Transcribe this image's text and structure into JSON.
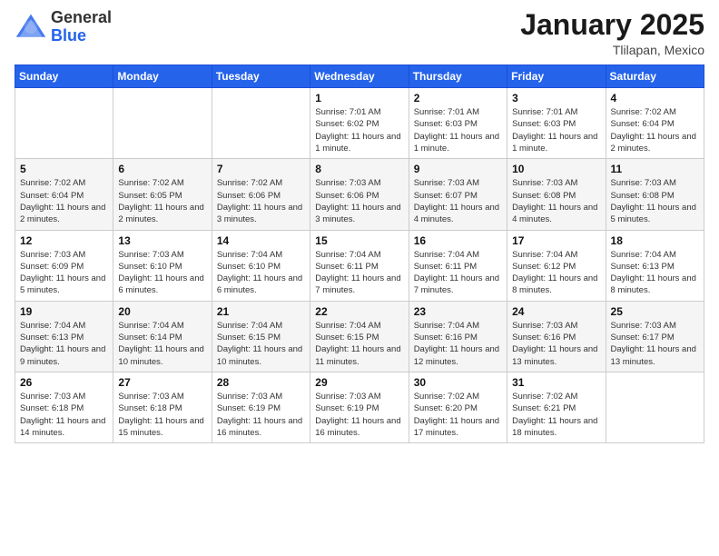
{
  "header": {
    "logo_general": "General",
    "logo_blue": "Blue",
    "month_title": "January 2025",
    "location": "Tlilapan, Mexico"
  },
  "weekdays": [
    "Sunday",
    "Monday",
    "Tuesday",
    "Wednesday",
    "Thursday",
    "Friday",
    "Saturday"
  ],
  "weeks": [
    [
      {
        "day": "",
        "info": ""
      },
      {
        "day": "",
        "info": ""
      },
      {
        "day": "",
        "info": ""
      },
      {
        "day": "1",
        "info": "Sunrise: 7:01 AM\nSunset: 6:02 PM\nDaylight: 11 hours\nand 1 minute."
      },
      {
        "day": "2",
        "info": "Sunrise: 7:01 AM\nSunset: 6:03 PM\nDaylight: 11 hours\nand 1 minute."
      },
      {
        "day": "3",
        "info": "Sunrise: 7:01 AM\nSunset: 6:03 PM\nDaylight: 11 hours\nand 1 minute."
      },
      {
        "day": "4",
        "info": "Sunrise: 7:02 AM\nSunset: 6:04 PM\nDaylight: 11 hours\nand 2 minutes."
      }
    ],
    [
      {
        "day": "5",
        "info": "Sunrise: 7:02 AM\nSunset: 6:04 PM\nDaylight: 11 hours\nand 2 minutes."
      },
      {
        "day": "6",
        "info": "Sunrise: 7:02 AM\nSunset: 6:05 PM\nDaylight: 11 hours\nand 2 minutes."
      },
      {
        "day": "7",
        "info": "Sunrise: 7:02 AM\nSunset: 6:06 PM\nDaylight: 11 hours\nand 3 minutes."
      },
      {
        "day": "8",
        "info": "Sunrise: 7:03 AM\nSunset: 6:06 PM\nDaylight: 11 hours\nand 3 minutes."
      },
      {
        "day": "9",
        "info": "Sunrise: 7:03 AM\nSunset: 6:07 PM\nDaylight: 11 hours\nand 4 minutes."
      },
      {
        "day": "10",
        "info": "Sunrise: 7:03 AM\nSunset: 6:08 PM\nDaylight: 11 hours\nand 4 minutes."
      },
      {
        "day": "11",
        "info": "Sunrise: 7:03 AM\nSunset: 6:08 PM\nDaylight: 11 hours\nand 5 minutes."
      }
    ],
    [
      {
        "day": "12",
        "info": "Sunrise: 7:03 AM\nSunset: 6:09 PM\nDaylight: 11 hours\nand 5 minutes."
      },
      {
        "day": "13",
        "info": "Sunrise: 7:03 AM\nSunset: 6:10 PM\nDaylight: 11 hours\nand 6 minutes."
      },
      {
        "day": "14",
        "info": "Sunrise: 7:04 AM\nSunset: 6:10 PM\nDaylight: 11 hours\nand 6 minutes."
      },
      {
        "day": "15",
        "info": "Sunrise: 7:04 AM\nSunset: 6:11 PM\nDaylight: 11 hours\nand 7 minutes."
      },
      {
        "day": "16",
        "info": "Sunrise: 7:04 AM\nSunset: 6:11 PM\nDaylight: 11 hours\nand 7 minutes."
      },
      {
        "day": "17",
        "info": "Sunrise: 7:04 AM\nSunset: 6:12 PM\nDaylight: 11 hours\nand 8 minutes."
      },
      {
        "day": "18",
        "info": "Sunrise: 7:04 AM\nSunset: 6:13 PM\nDaylight: 11 hours\nand 8 minutes."
      }
    ],
    [
      {
        "day": "19",
        "info": "Sunrise: 7:04 AM\nSunset: 6:13 PM\nDaylight: 11 hours\nand 9 minutes."
      },
      {
        "day": "20",
        "info": "Sunrise: 7:04 AM\nSunset: 6:14 PM\nDaylight: 11 hours\nand 10 minutes."
      },
      {
        "day": "21",
        "info": "Sunrise: 7:04 AM\nSunset: 6:15 PM\nDaylight: 11 hours\nand 10 minutes."
      },
      {
        "day": "22",
        "info": "Sunrise: 7:04 AM\nSunset: 6:15 PM\nDaylight: 11 hours\nand 11 minutes."
      },
      {
        "day": "23",
        "info": "Sunrise: 7:04 AM\nSunset: 6:16 PM\nDaylight: 11 hours\nand 12 minutes."
      },
      {
        "day": "24",
        "info": "Sunrise: 7:03 AM\nSunset: 6:16 PM\nDaylight: 11 hours\nand 13 minutes."
      },
      {
        "day": "25",
        "info": "Sunrise: 7:03 AM\nSunset: 6:17 PM\nDaylight: 11 hours\nand 13 minutes."
      }
    ],
    [
      {
        "day": "26",
        "info": "Sunrise: 7:03 AM\nSunset: 6:18 PM\nDaylight: 11 hours\nand 14 minutes."
      },
      {
        "day": "27",
        "info": "Sunrise: 7:03 AM\nSunset: 6:18 PM\nDaylight: 11 hours\nand 15 minutes."
      },
      {
        "day": "28",
        "info": "Sunrise: 7:03 AM\nSunset: 6:19 PM\nDaylight: 11 hours\nand 16 minutes."
      },
      {
        "day": "29",
        "info": "Sunrise: 7:03 AM\nSunset: 6:19 PM\nDaylight: 11 hours\nand 16 minutes."
      },
      {
        "day": "30",
        "info": "Sunrise: 7:02 AM\nSunset: 6:20 PM\nDaylight: 11 hours\nand 17 minutes."
      },
      {
        "day": "31",
        "info": "Sunrise: 7:02 AM\nSunset: 6:21 PM\nDaylight: 11 hours\nand 18 minutes."
      },
      {
        "day": "",
        "info": ""
      }
    ]
  ]
}
